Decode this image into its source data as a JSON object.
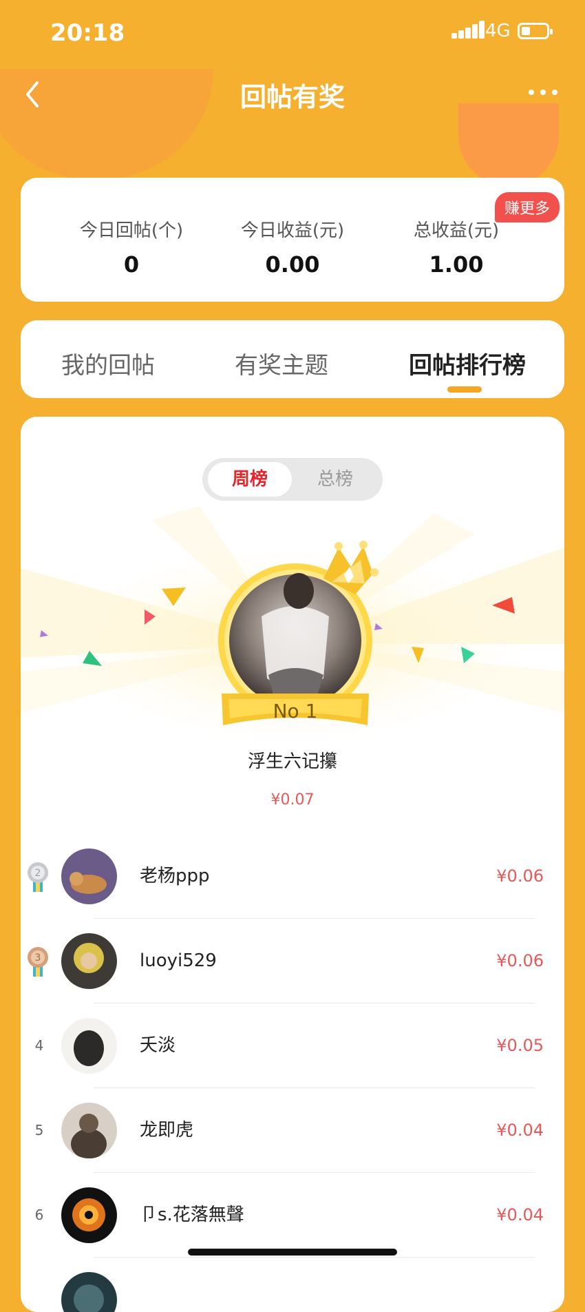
{
  "status_bar": {
    "time": "20:18",
    "network": "4G"
  },
  "nav": {
    "title": "回帖有奖"
  },
  "stats": {
    "badge": "赚更多",
    "items": [
      {
        "label": "今日回帖(个)",
        "value": "0"
      },
      {
        "label": "今日收益(元)",
        "value": "0.00"
      },
      {
        "label": "总收益(元)",
        "value": "1.00"
      }
    ]
  },
  "tabs": [
    {
      "label": "我的回帖",
      "active": false
    },
    {
      "label": "有奖主题",
      "active": false
    },
    {
      "label": "回帖排行榜",
      "active": true
    }
  ],
  "ranking": {
    "toggle": {
      "selected": "周榜",
      "other": "总榜"
    },
    "first": {
      "tag": "No 1",
      "name": "浮生六记攥",
      "amount": "¥0.07"
    },
    "rows": [
      {
        "rank": "2",
        "name": "老杨ppp",
        "amount": "¥0.06",
        "medal": "silver"
      },
      {
        "rank": "3",
        "name": "luoyi529",
        "amount": "¥0.06",
        "medal": "bronze"
      },
      {
        "rank": "4",
        "name": "夭淡",
        "amount": "¥0.05"
      },
      {
        "rank": "5",
        "name": "龙即虎",
        "amount": "¥0.04"
      },
      {
        "rank": "6",
        "name": "卩s.花落無聲",
        "amount": "¥0.04"
      }
    ]
  },
  "colors": {
    "background": "#F5B02F",
    "accent": "#E85858",
    "tab_indicator": "#F5A623",
    "badge": "#F2504C"
  }
}
